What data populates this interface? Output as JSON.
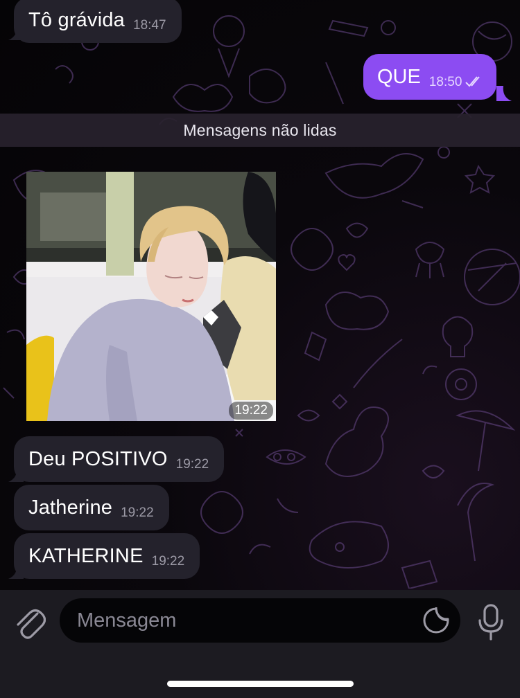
{
  "chat": {
    "messages": [
      {
        "text": "Tô grávida",
        "time": "18:47"
      },
      {
        "text": "QUE",
        "time": "18:50"
      },
      {
        "time": "19:22"
      },
      {
        "text": "Deu POSITIVO",
        "time": "19:22"
      },
      {
        "text": "Jatherine",
        "time": "19:22"
      },
      {
        "text": "KATHERINE",
        "time": "19:22"
      }
    ],
    "unread_divider": "Mensagens não lidas"
  },
  "composer": {
    "placeholder": "Mensagem",
    "attach_icon": "paperclip-icon",
    "sticker_icon": "sticker-icon",
    "mic_icon": "microphone-icon"
  },
  "colors": {
    "outgoing_bubble": "#8c4cf2",
    "incoming_bubble": "#24222c",
    "wallpaper_doodle": "#7a4f9c"
  }
}
